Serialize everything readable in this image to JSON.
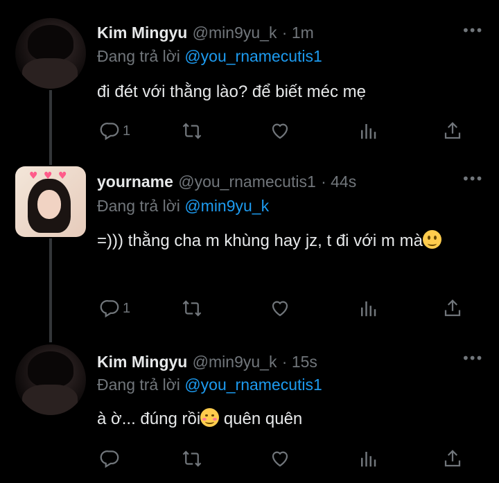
{
  "tweets": [
    {
      "name": "Kim Mingyu",
      "handle": "@min9yu_k",
      "time": "· 1m",
      "reply_prefix": "Đang trả lời",
      "reply_to": "@you_rnamecutis1",
      "text": "đi đét với thằng lào? để biết méc mẹ",
      "text_suffix": "",
      "reply_count": "1",
      "avatar": "man-avatar"
    },
    {
      "name": "yourname",
      "handle": "@you_rnamecutis1",
      "time": "· 44s",
      "reply_prefix": "Đang trả lời",
      "reply_to": "@min9yu_k",
      "text": "=))) thằng cha m khùng hay jz, t đi với m mà",
      "text_suffix": "",
      "reply_count": "1",
      "avatar": "girl-avatar",
      "emoji": "slightly-smiling-face"
    },
    {
      "name": "Kim Mingyu",
      "handle": "@min9yu_k",
      "time": "· 15s",
      "reply_prefix": "Đang trả lời",
      "reply_to": "@you_rnamecutis1",
      "text_before_emoji": "à ờ... đúng rồi",
      "text_after_emoji": " quên quên",
      "reply_count": "",
      "avatar": "man-avatar",
      "emoji": "smiling-face-blush"
    }
  ],
  "icons": {
    "more": "more-dots-icon",
    "reply": "reply-icon",
    "retweet": "retweet-icon",
    "like": "heart-icon",
    "views": "views-icon",
    "share": "share-icon"
  },
  "colors": {
    "background": "#000000",
    "text": "#e7e9ea",
    "muted": "#71767b",
    "link": "#1d9bf0",
    "thread_line": "#333639"
  }
}
